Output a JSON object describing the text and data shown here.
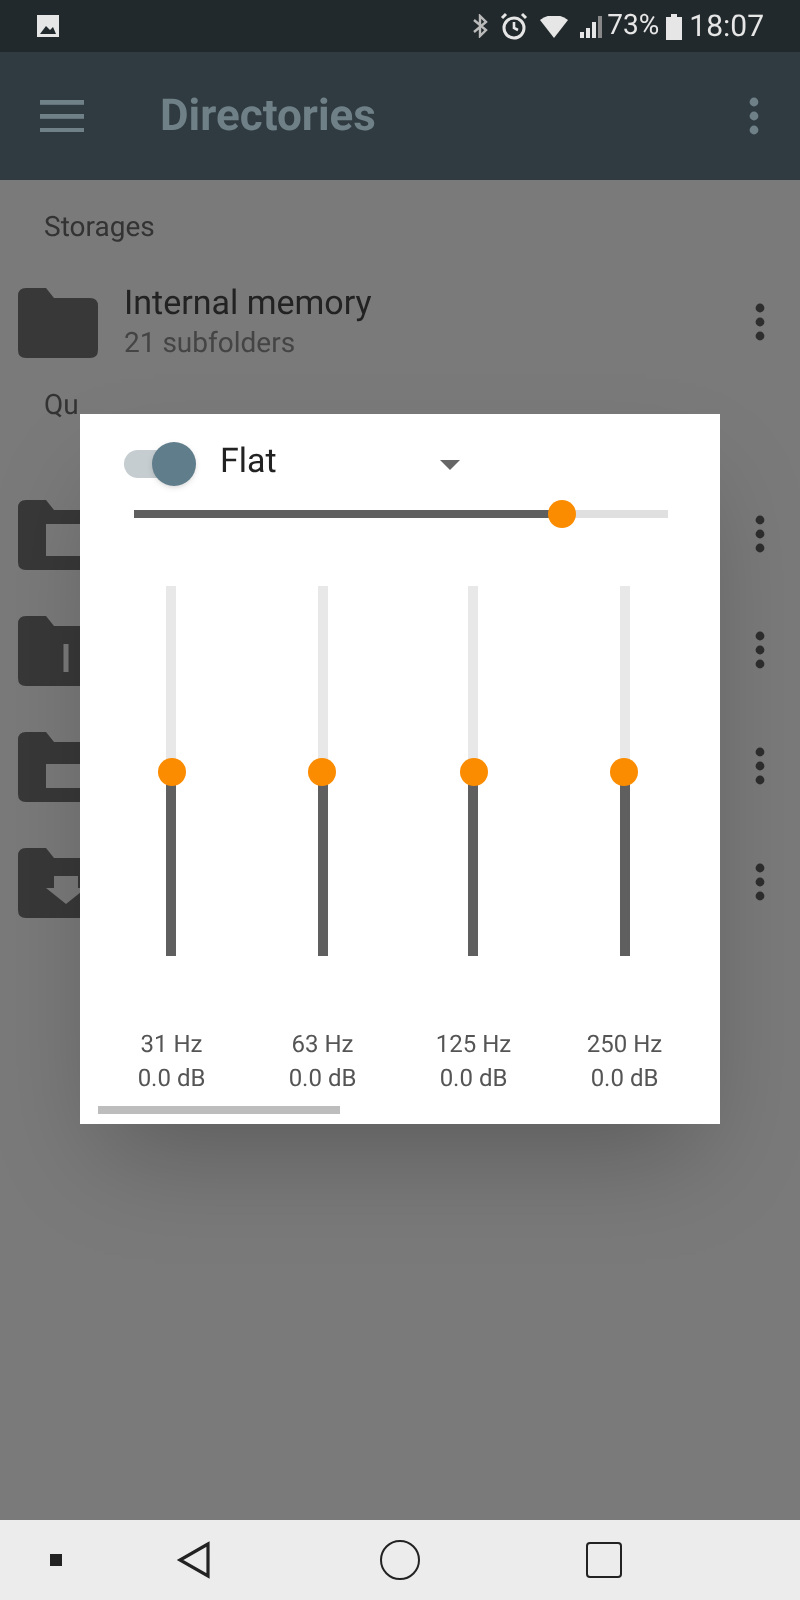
{
  "status_bar": {
    "battery": "73%",
    "time": "18:07"
  },
  "app_bar": {
    "title": "Directories"
  },
  "storages": {
    "header": "Storages",
    "items": [
      {
        "name": "Internal memory",
        "detail": "21 subfolders"
      }
    ]
  },
  "quick_access": {
    "header": "Qu",
    "rows": [
      {
        "kind": "video"
      },
      {
        "kind": "music"
      },
      {
        "kind": "radio"
      },
      {
        "kind": "download"
      }
    ]
  },
  "equalizer": {
    "enabled": true,
    "preset": "Flat",
    "level": 0.8,
    "bands": [
      {
        "frequency": "31 Hz",
        "gain": "0.0 dB",
        "level": 0.5
      },
      {
        "frequency": "63 Hz",
        "gain": "0.0 dB",
        "level": 0.5
      },
      {
        "frequency": "125 Hz",
        "gain": "0.0 dB",
        "level": 0.5
      },
      {
        "frequency": "250 Hz",
        "gain": "0.0 dB",
        "level": 0.5
      }
    ]
  }
}
